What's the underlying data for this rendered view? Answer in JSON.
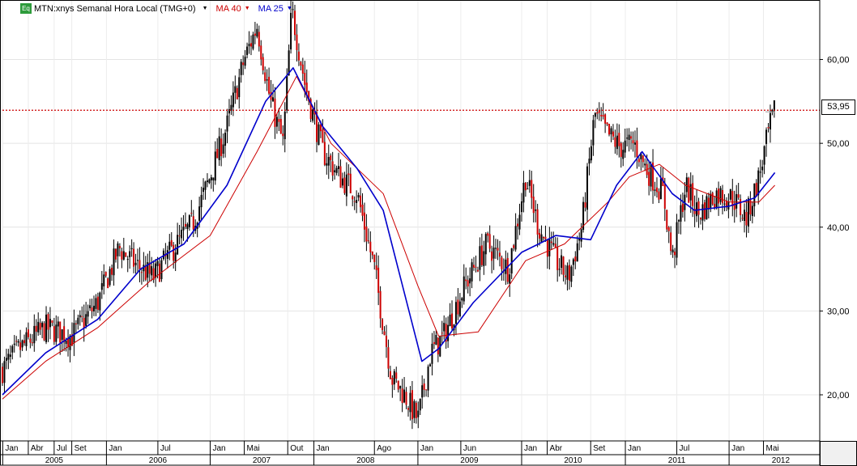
{
  "legend": {
    "badge": "Eq",
    "symbol": "MTN:xnys Semanal Hora Local (TMG+0)",
    "ma_slow": "MA 40",
    "ma_fast": "MA 25",
    "ma_slow_color": "#cc0000",
    "ma_fast_color": "#0000cc",
    "arrow_glyph": "▼"
  },
  "price_tag": "53,95",
  "chart_data": {
    "type": "line",
    "series": [
      {
        "kind": "ohlc",
        "color": "#000000",
        "down_color": "#cc0000",
        "x": [
          "2004-12-31",
          "2005-03-01",
          "2005-06-01",
          "2005-09-01",
          "2005-12-01",
          "2006-02-15",
          "2006-04-15",
          "2006-06-15",
          "2006-08-15",
          "2006-11-01",
          "2007-01-01",
          "2007-03-01",
          "2007-05-01",
          "2007-06-15",
          "2007-08-01",
          "2007-09-15",
          "2007-10-15",
          "2007-12-01",
          "2008-02-01",
          "2008-04-01",
          "2008-06-01",
          "2008-08-01",
          "2008-10-01",
          "2008-11-15",
          "2009-01-01",
          "2009-02-15",
          "2009-04-01",
          "2009-06-15",
          "2009-09-01",
          "2009-11-15",
          "2010-01-15",
          "2010-03-01",
          "2010-05-01",
          "2010-06-15",
          "2010-08-01",
          "2010-09-15",
          "2010-11-01",
          "2010-12-15",
          "2011-02-01",
          "2011-03-15",
          "2011-05-15",
          "2011-06-15",
          "2011-08-01",
          "2011-09-15",
          "2011-11-15",
          "2012-01-15",
          "2012-03-01",
          "2012-04-15",
          "2012-05-20",
          "2012-06-10"
        ],
        "close": [
          23.0,
          25.5,
          28.0,
          27.0,
          31.0,
          37.5,
          35.5,
          34.0,
          37.0,
          40.5,
          46.0,
          52.0,
          60.0,
          64.0,
          55.0,
          50.0,
          66.0,
          57.0,
          49.0,
          46.0,
          44.0,
          35.0,
          22.0,
          20.0,
          17.0,
          25.0,
          27.0,
          33.0,
          38.0,
          35.0,
          46.0,
          40.0,
          36.0,
          34.0,
          40.0,
          53.5,
          51.0,
          49.5,
          50.0,
          47.0,
          44.0,
          36.0,
          45.0,
          41.5,
          44.0,
          43.5,
          41.0,
          46.0,
          51.5,
          53.95
        ]
      },
      {
        "name": "MA 40",
        "color": "#cc0000",
        "x": [
          "2004-12-31",
          "2005-06-01",
          "2005-12-01",
          "2006-06-01",
          "2007-01-01",
          "2007-06-15",
          "2007-11-01",
          "2008-03-01",
          "2008-09-01",
          "2009-01-01",
          "2009-03-15",
          "2009-08-01",
          "2010-01-15",
          "2010-06-01",
          "2010-11-01",
          "2011-01-15",
          "2011-05-01",
          "2011-08-01",
          "2012-01-01",
          "2012-04-15",
          "2012-06-10"
        ],
        "values": [
          19.5,
          24.0,
          28.0,
          33.5,
          39.0,
          49.0,
          58.0,
          50.0,
          44.0,
          33.0,
          27.0,
          27.5,
          36.0,
          38.0,
          43.0,
          46.0,
          47.5,
          45.0,
          43.0,
          43.0,
          45.0
        ]
      },
      {
        "name": "MA 25",
        "color": "#0000cc",
        "x": [
          "2004-12-31",
          "2005-06-01",
          "2005-12-01",
          "2006-05-01",
          "2006-10-01",
          "2007-03-01",
          "2007-07-15",
          "2007-10-20",
          "2008-02-01",
          "2008-06-01",
          "2008-09-01",
          "2009-01-15",
          "2009-03-15",
          "2009-07-15",
          "2010-01-01",
          "2010-05-01",
          "2010-09-01",
          "2010-12-01",
          "2011-03-01",
          "2011-06-15",
          "2011-09-01",
          "2012-01-01",
          "2012-04-01",
          "2012-06-10"
        ],
        "values": [
          20.0,
          25.0,
          29.0,
          35.0,
          38.0,
          45.0,
          55.0,
          59.0,
          52.0,
          47.0,
          42.0,
          24.0,
          25.5,
          31.0,
          37.0,
          39.0,
          38.5,
          45.0,
          49.0,
          44.0,
          42.0,
          42.5,
          43.5,
          46.5
        ]
      }
    ],
    "reference_lines": [
      {
        "y": 53.95,
        "color": "#cc0000",
        "style": "dotted"
      }
    ],
    "y_ticks": [
      "20,00",
      "30,00",
      "40,00",
      "50,00",
      "60,00"
    ],
    "y_tick_values": [
      20,
      30,
      40,
      50,
      60
    ],
    "ylim": [
      14.5,
      67.0
    ],
    "xlim": [
      "2004-12-31",
      "2012-11-15"
    ],
    "x_month_labels": [
      {
        "date": "2005-01-01",
        "label": "Jan"
      },
      {
        "date": "2005-04-01",
        "label": "Abr"
      },
      {
        "date": "2005-07-01",
        "label": "Jul"
      },
      {
        "date": "2005-09-01",
        "label": "Set"
      },
      {
        "date": "2006-01-01",
        "label": "Jan"
      },
      {
        "date": "2006-07-01",
        "label": "Jul"
      },
      {
        "date": "2007-01-01",
        "label": "Jan"
      },
      {
        "date": "2007-05-01",
        "label": "Mai"
      },
      {
        "date": "2007-10-01",
        "label": "Out"
      },
      {
        "date": "2008-01-01",
        "label": "Jan"
      },
      {
        "date": "2008-08-01",
        "label": "Ago"
      },
      {
        "date": "2009-01-01",
        "label": "Jan"
      },
      {
        "date": "2009-06-01",
        "label": "Jun"
      },
      {
        "date": "2010-01-01",
        "label": "Jan"
      },
      {
        "date": "2010-04-01",
        "label": "Abr"
      },
      {
        "date": "2010-09-01",
        "label": "Set"
      },
      {
        "date": "2011-01-01",
        "label": "Jan"
      },
      {
        "date": "2011-07-01",
        "label": "Jul"
      },
      {
        "date": "2012-01-01",
        "label": "Jan"
      },
      {
        "date": "2012-05-01",
        "label": "Mai"
      }
    ],
    "x_year_labels": [
      {
        "date": "2005-07-01",
        "label": "2005"
      },
      {
        "date": "2006-07-01",
        "label": "2006"
      },
      {
        "date": "2007-07-01",
        "label": "2007"
      },
      {
        "date": "2008-07-01",
        "label": "2008"
      },
      {
        "date": "2009-07-01",
        "label": "2009"
      },
      {
        "date": "2010-07-01",
        "label": "2010"
      },
      {
        "date": "2011-07-01",
        "label": "2011"
      },
      {
        "date": "2012-07-01",
        "label": "2012"
      }
    ],
    "grid": true
  }
}
